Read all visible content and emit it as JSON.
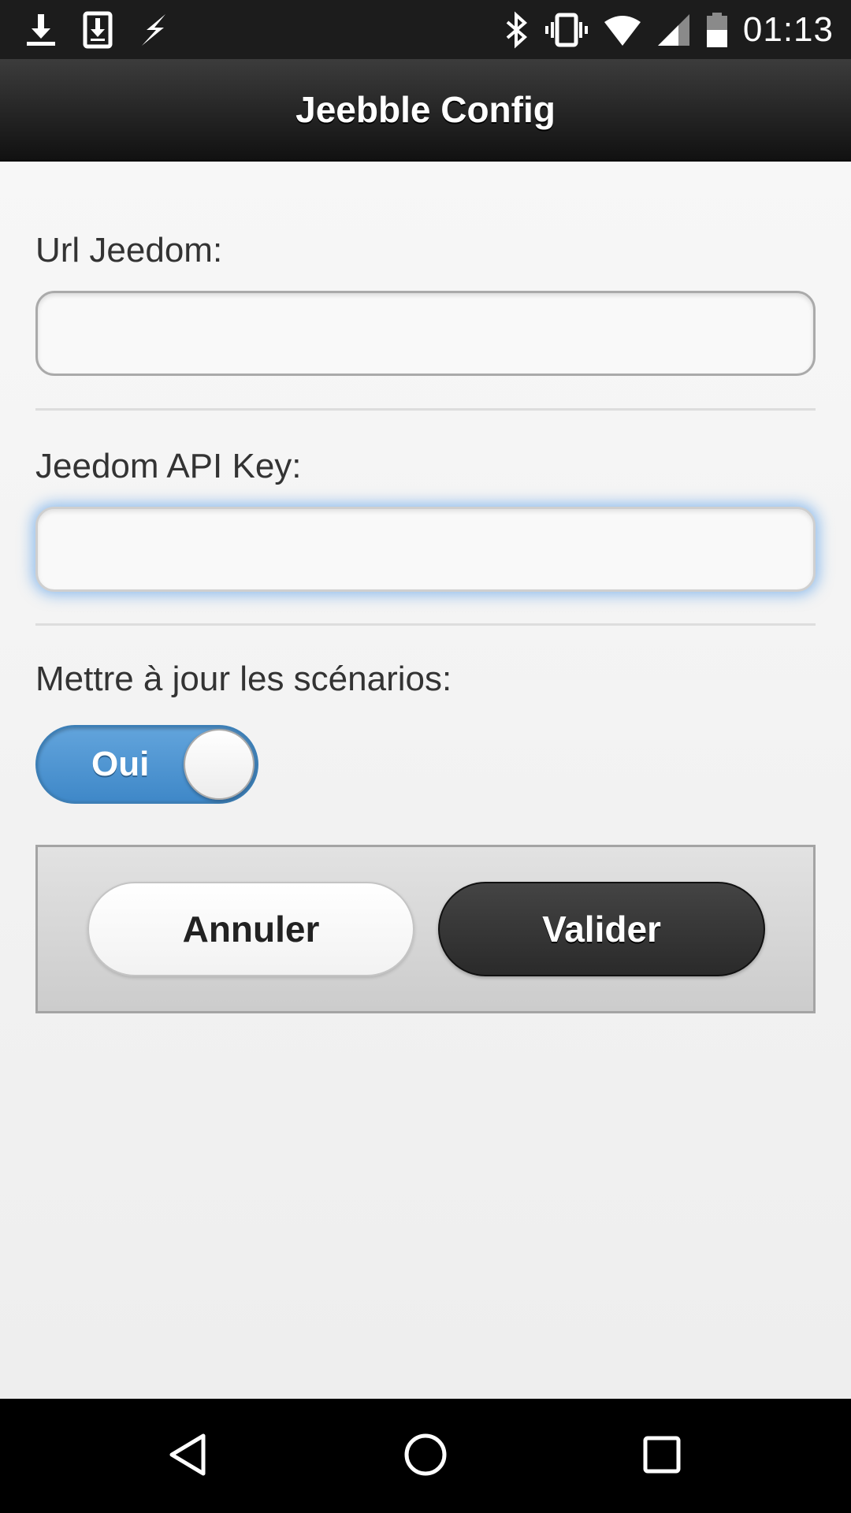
{
  "status_bar": {
    "left_icons": [
      "download-icon",
      "download-box-icon",
      "flash-icon"
    ],
    "right_icons": [
      "bluetooth-icon",
      "vibrate-icon",
      "wifi-icon",
      "signal-icon",
      "battery-icon"
    ],
    "time": "01:13"
  },
  "header": {
    "title": "Jeebble Config"
  },
  "form": {
    "url_label": "Url Jeedom:",
    "url_value": "",
    "api_key_label": "Jeedom API Key:",
    "api_key_value": "",
    "update_label": "Mettre à jour les scénarios:",
    "toggle_label": "Oui",
    "toggle_on": true
  },
  "actions": {
    "cancel_label": "Annuler",
    "submit_label": "Valider"
  },
  "nav": {
    "buttons": [
      "back-icon",
      "home-icon",
      "recents-icon"
    ]
  },
  "colors": {
    "status_bar": "#1c1c1c",
    "header_top": "#3c3c3c",
    "header_bottom": "#111111",
    "toggle_on": "#4a90d0",
    "focus_glow": "#388ce6",
    "submit_button": "#333333"
  }
}
